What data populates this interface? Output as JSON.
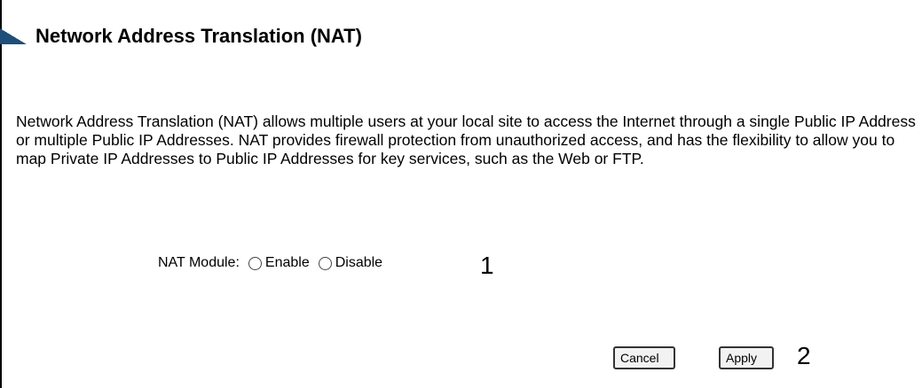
{
  "header": {
    "title": "Network Address Translation (NAT)"
  },
  "description": "Network Address Translation (NAT) allows multiple users at your local site to access the Internet through a single Public IP Address or multiple Public IP Addresses. NAT provides firewall protection from unauthorized access, and has the flexibility to allow you to map Private IP Addresses to Public IP Addresses for key services, such as the Web or FTP.",
  "nat_module": {
    "label": "NAT Module:",
    "options": [
      "Enable",
      "Disable"
    ],
    "selected": null
  },
  "annotations": [
    "1",
    "2"
  ],
  "buttons": {
    "cancel_label": "Cancel",
    "apply_label": "Apply"
  },
  "colors": {
    "title_arrow": "#1f4e79"
  }
}
